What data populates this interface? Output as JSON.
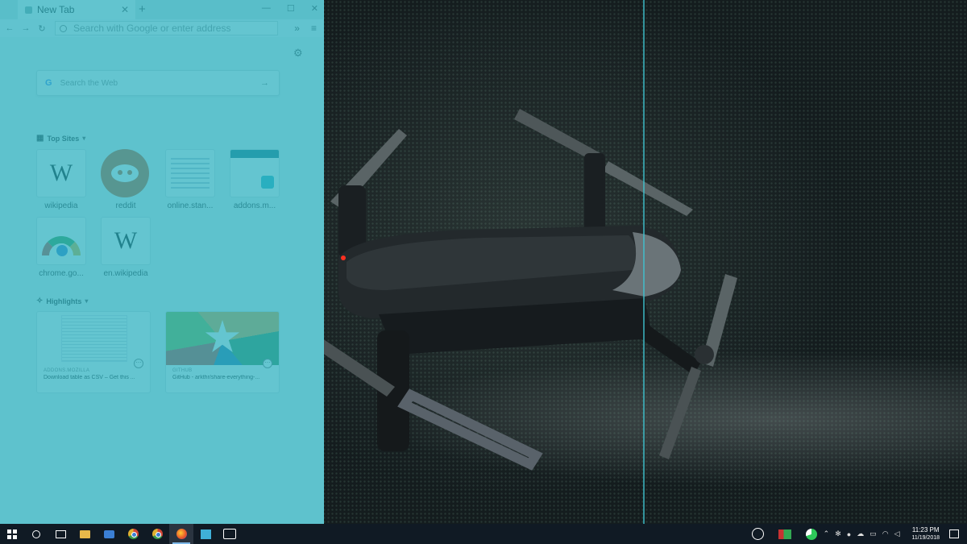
{
  "browser": {
    "tab_title": "New Tab",
    "tab_close": "✕",
    "new_tab": "+",
    "window_buttons": [
      "—",
      "☐",
      "✕"
    ],
    "address_placeholder": "Search with Google or enter address",
    "overflow": "»",
    "menu": "≡"
  },
  "newtab_page": {
    "search_logo": "G",
    "search_placeholder": "Search the Web",
    "search_arrow": "→",
    "top_sites_label": "Top Sites",
    "top_sites": [
      {
        "label": "wikipedia",
        "icon": "wikipedia-w"
      },
      {
        "label": "reddit",
        "icon": "reddit-alien"
      },
      {
        "label": "online.stan...",
        "icon": "page-thumbnail"
      },
      {
        "label": "addons.m...",
        "icon": "addons-thumbnail"
      },
      {
        "label": "chrome.go...",
        "icon": "chrome-logo"
      },
      {
        "label": "en.wikipedia",
        "icon": "wikipedia-w"
      }
    ],
    "highlights_label": "Highlights",
    "highlights": [
      {
        "source": "ADDONS.MOZILLA",
        "title": "Download table as CSV – Get this ..."
      },
      {
        "source": "GITHUB",
        "title": "GitHub - arkthr/share-everything-..."
      }
    ]
  },
  "taskbar": {
    "apps": [
      "start",
      "cortana",
      "task-view",
      "file-explorer",
      "app",
      "chrome",
      "chrome",
      "firefox",
      "app",
      "photos"
    ],
    "clock_time": "11:23 PM",
    "clock_date": "11/19/2018"
  },
  "colors": {
    "snap_overlay": "#28afbe",
    "taskbar": "#101a24",
    "accent": "#3ec3d0"
  }
}
